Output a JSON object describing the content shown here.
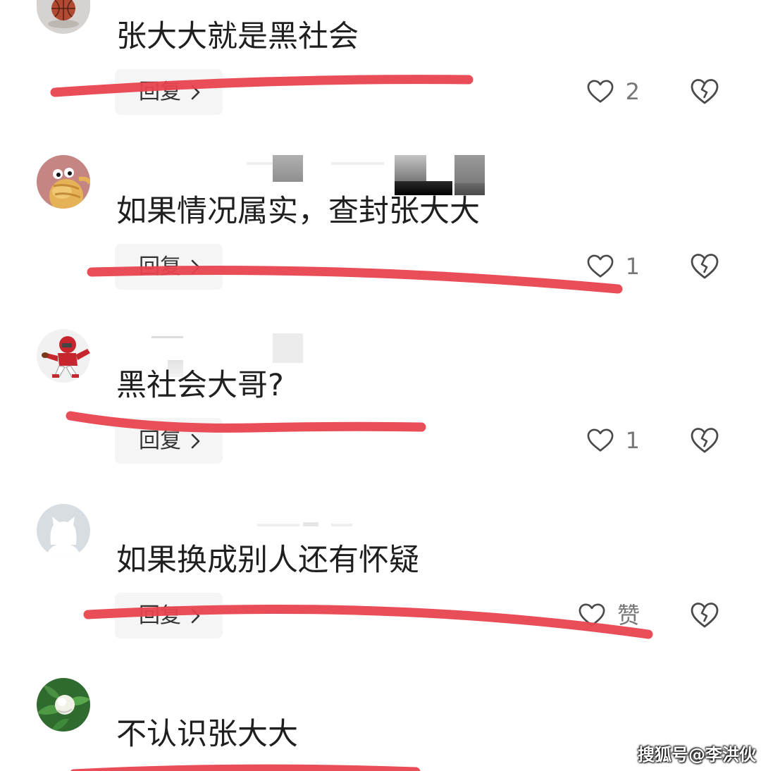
{
  "comments": [
    {
      "text": "张大大就是黑社会",
      "reply": "回复",
      "likes": "2"
    },
    {
      "text": "如果情况属实，查封张大大",
      "reply": "回复",
      "likes": "1"
    },
    {
      "text": "黑社会大哥?",
      "reply": "回复",
      "likes": "1"
    },
    {
      "text": "如果换成别人还有怀疑",
      "reply": "回复",
      "likes": "赞"
    },
    {
      "text": "不认识张大大"
    }
  ],
  "icons": {
    "like": "heart-outline-icon",
    "dislike": "broken-heart-icon",
    "reply_chevron": "chevron-right-icon"
  },
  "watermark": "搜狐号@李洪伙",
  "colors": {
    "annotation_red": "#e8434f",
    "reply_button_bg": "#f5f5f5",
    "comment_text": "#1f1f1f",
    "count_text": "#777777"
  }
}
